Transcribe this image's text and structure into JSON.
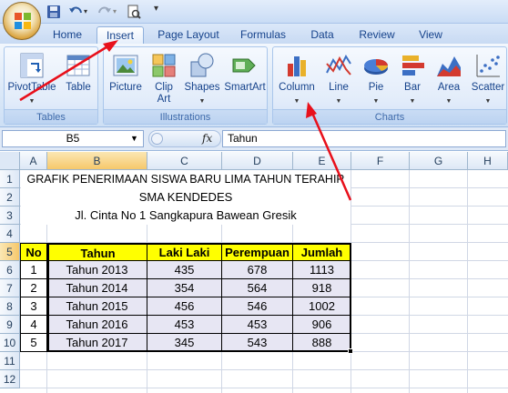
{
  "tabs": [
    "Home",
    "Insert",
    "Page Layout",
    "Formulas",
    "Data",
    "Review",
    "View"
  ],
  "active_tab": "Insert",
  "ribbon": {
    "tables_group": {
      "label": "Tables",
      "pivot": "PivotTable",
      "table": "Table"
    },
    "illustrations_group": {
      "label": "Illustrations",
      "picture": "Picture",
      "clip_art_1": "Clip",
      "clip_art_2": "Art",
      "shapes": "Shapes",
      "smartart": "SmartArt"
    },
    "charts_group": {
      "label": "Charts",
      "column": "Column",
      "line": "Line",
      "pie": "Pie",
      "bar": "Bar",
      "area": "Area",
      "scatter": "Scatter"
    }
  },
  "formula_bar": {
    "name_box": "B5",
    "fx": "fx",
    "value": "Tahun"
  },
  "columns": [
    "A",
    "B",
    "C",
    "D",
    "E",
    "F",
    "G",
    "H"
  ],
  "rows": [
    "1",
    "2",
    "3",
    "4",
    "5",
    "6",
    "7",
    "8",
    "9",
    "10",
    "11",
    "12"
  ],
  "sheet": {
    "title1": "GRAFIK PENERIMAAN SISWA BARU LIMA TAHUN TERAHIR",
    "title2": "SMA KENDEDES",
    "title3": "Jl. Cinta No 1 Sangkapura Bawean Gresik",
    "headers": {
      "no": "No",
      "tahun": "Tahun",
      "laki": "Laki Laki",
      "perempuan": "Perempuan",
      "jumlah": "Jumlah"
    },
    "data": [
      {
        "no": "1",
        "tahun": "Tahun 2013",
        "laki": "435",
        "perempuan": "678",
        "jumlah": "1113"
      },
      {
        "no": "2",
        "tahun": "Tahun 2014",
        "laki": "354",
        "perempuan": "564",
        "jumlah": "918"
      },
      {
        "no": "3",
        "tahun": "Tahun 2015",
        "laki": "456",
        "perempuan": "546",
        "jumlah": "1002"
      },
      {
        "no": "4",
        "tahun": "Tahun 2016",
        "laki": "453",
        "perempuan": "453",
        "jumlah": "906"
      },
      {
        "no": "5",
        "tahun": "Tahun 2017",
        "laki": "345",
        "perempuan": "543",
        "jumlah": "888"
      }
    ]
  },
  "colors": {
    "header_fill": "#ffff00",
    "body_fill": "#e7e6f3",
    "arrow": "#e8101b"
  }
}
